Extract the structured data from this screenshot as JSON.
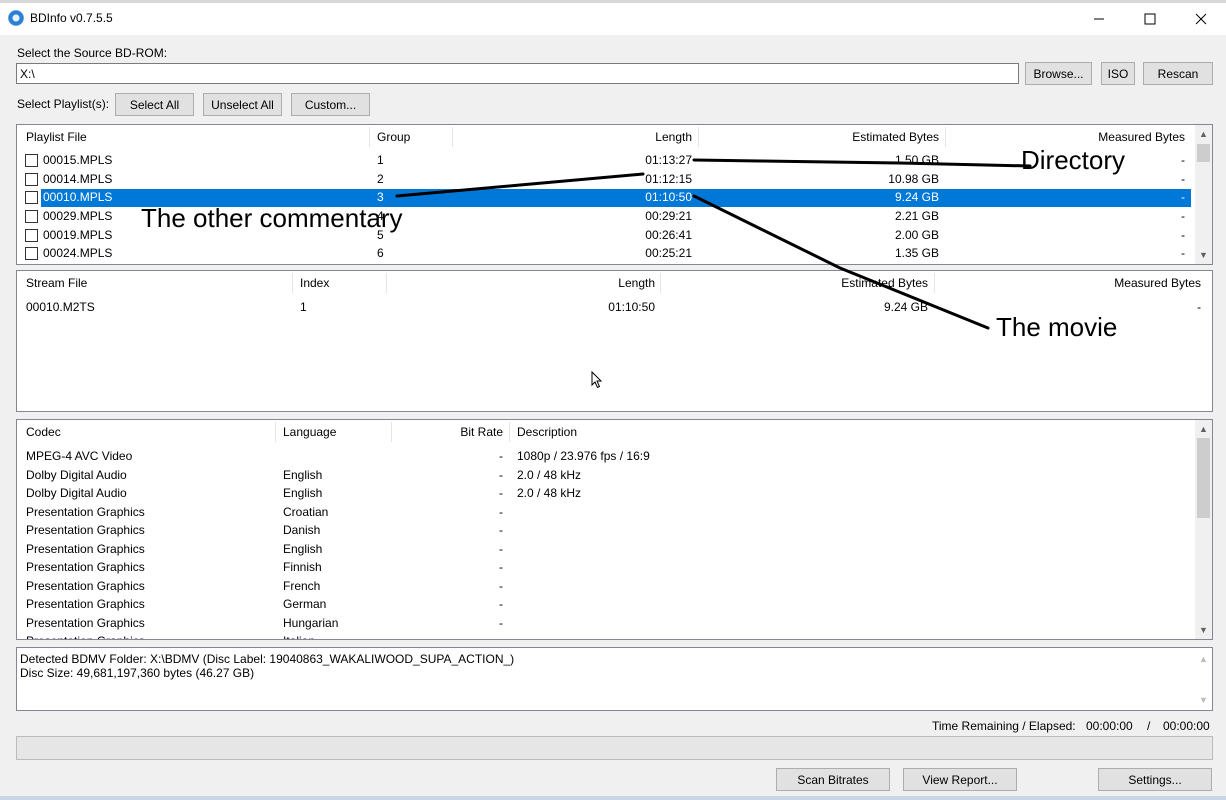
{
  "window": {
    "title": "BDInfo v0.7.5.5",
    "controls": {
      "minimize": "minimize-icon",
      "maximize": "maximize-icon",
      "close": "close-icon"
    }
  },
  "source": {
    "label": "Select the Source BD-ROM:",
    "path": "X:\\",
    "browse": "Browse...",
    "iso": "ISO",
    "rescan": "Rescan"
  },
  "playlist_select": {
    "label": "Select Playlist(s):",
    "select_all": "Select All",
    "unselect_all": "Unselect All",
    "custom": "Custom..."
  },
  "playlists": {
    "headers": [
      "Playlist File",
      "Group",
      "Length",
      "Estimated Bytes",
      "Measured Bytes"
    ],
    "rows": [
      {
        "file": "00015.MPLS",
        "group": "1",
        "length": "01:13:27",
        "est": "1.50 GB",
        "measured": "-",
        "selected": false
      },
      {
        "file": "00014.MPLS",
        "group": "2",
        "length": "01:12:15",
        "est": "10.98 GB",
        "measured": "-",
        "selected": false
      },
      {
        "file": "00010.MPLS",
        "group": "3",
        "length": "01:10:50",
        "est": "9.24 GB",
        "measured": "-",
        "selected": true
      },
      {
        "file": "00029.MPLS",
        "group": "4",
        "length": "00:29:21",
        "est": "2.21 GB",
        "measured": "-",
        "selected": false
      },
      {
        "file": "00019.MPLS",
        "group": "5",
        "length": "00:26:41",
        "est": "2.00 GB",
        "measured": "-",
        "selected": false
      },
      {
        "file": "00024.MPLS",
        "group": "6",
        "length": "00:25:21",
        "est": "1.35 GB",
        "measured": "-",
        "selected": false
      }
    ]
  },
  "streams": {
    "headers": [
      "Stream File",
      "Index",
      "Length",
      "Estimated Bytes",
      "Measured Bytes"
    ],
    "rows": [
      {
        "file": "00010.M2TS",
        "index": "1",
        "length": "01:10:50",
        "est": "9.24 GB",
        "measured": "-"
      }
    ]
  },
  "codecs": {
    "headers": [
      "Codec",
      "Language",
      "Bit Rate",
      "Description"
    ],
    "rows": [
      {
        "codec": "MPEG-4 AVC Video",
        "language": "",
        "bitrate": "-",
        "description": "1080p / 23.976 fps / 16:9"
      },
      {
        "codec": "Dolby Digital Audio",
        "language": "English",
        "bitrate": "-",
        "description": "2.0 / 48 kHz"
      },
      {
        "codec": "Dolby Digital Audio",
        "language": "English",
        "bitrate": "-",
        "description": "2.0 / 48 kHz"
      },
      {
        "codec": "Presentation Graphics",
        "language": "Croatian",
        "bitrate": "-",
        "description": ""
      },
      {
        "codec": "Presentation Graphics",
        "language": "Danish",
        "bitrate": "-",
        "description": ""
      },
      {
        "codec": "Presentation Graphics",
        "language": "English",
        "bitrate": "-",
        "description": ""
      },
      {
        "codec": "Presentation Graphics",
        "language": "Finnish",
        "bitrate": "-",
        "description": ""
      },
      {
        "codec": "Presentation Graphics",
        "language": "French",
        "bitrate": "-",
        "description": ""
      },
      {
        "codec": "Presentation Graphics",
        "language": "German",
        "bitrate": "-",
        "description": ""
      },
      {
        "codec": "Presentation Graphics",
        "language": "Hungarian",
        "bitrate": "-",
        "description": ""
      },
      {
        "codec": "Presentation Graphics",
        "language": "Italian",
        "bitrate": "",
        "description": ""
      }
    ]
  },
  "info": {
    "line1": "Detected BDMV Folder: X:\\BDMV (Disc Label: 19040863_WAKALIWOOD_SUPA_ACTION_)",
    "line2": "Disc Size: 49,681,197,360 bytes (46.27 GB)"
  },
  "progress": {
    "label": "Time Remaining / Elapsed:",
    "remaining": "00:00:00",
    "separator": "/",
    "elapsed": "00:00:00",
    "fraction": 0
  },
  "bottom_buttons": {
    "scan": "Scan Bitrates",
    "report": "View Report...",
    "settings": "Settings..."
  },
  "annotations": {
    "directory": "Directory",
    "other_commentary": "The other commentary",
    "movie": "The movie"
  }
}
